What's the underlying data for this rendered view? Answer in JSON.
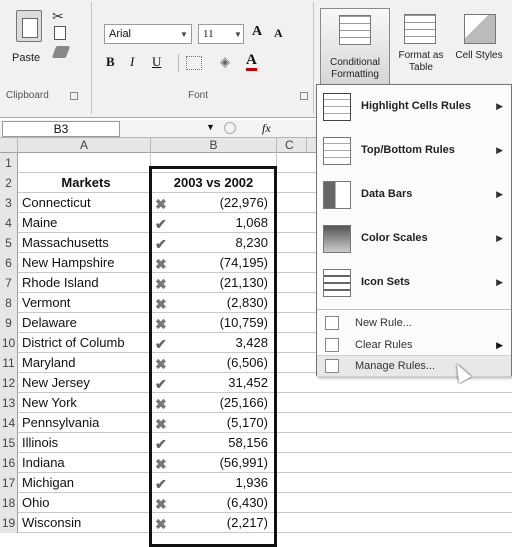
{
  "ribbon": {
    "clipboard": {
      "paste_label": "Paste",
      "group_label": "Clipboard"
    },
    "font": {
      "font_name": "Arial",
      "font_size": "11",
      "grow_label": "A",
      "shrink_label": "A",
      "bold_label": "B",
      "italic_label": "I",
      "underline_label": "U",
      "font_color_label": "A",
      "group_label": "Font"
    },
    "styles": {
      "conditional_formatting_label": "Conditional Formatting",
      "format_as_table_label": "Format as Table",
      "cell_styles_label": "Cell Styles"
    }
  },
  "formula_bar": {
    "name_box": "B3",
    "fx": "fx"
  },
  "grid": {
    "columns": [
      "A",
      "B",
      "C"
    ],
    "header_row": {
      "row_number": "2",
      "col_a": "Markets",
      "col_b": "2003 vs 2002"
    },
    "rows": [
      {
        "row_number": "3",
        "market": "Connecticut",
        "icon": "cross",
        "value": "(22,976)"
      },
      {
        "row_number": "4",
        "market": "Maine",
        "icon": "check",
        "value": "1,068"
      },
      {
        "row_number": "5",
        "market": "Massachusetts",
        "icon": "check",
        "value": "8,230"
      },
      {
        "row_number": "6",
        "market": "New Hampshire",
        "icon": "cross",
        "value": "(74,195)"
      },
      {
        "row_number": "7",
        "market": "Rhode Island",
        "icon": "cross",
        "value": "(21,130)"
      },
      {
        "row_number": "8",
        "market": "Vermont",
        "icon": "cross",
        "value": "(2,830)"
      },
      {
        "row_number": "9",
        "market": "Delaware",
        "icon": "cross",
        "value": "(10,759)"
      },
      {
        "row_number": "10",
        "market": "District of Columb",
        "icon": "check",
        "value": "3,428"
      },
      {
        "row_number": "11",
        "market": "Maryland",
        "icon": "cross",
        "value": "(6,506)"
      },
      {
        "row_number": "12",
        "market": "New Jersey",
        "icon": "check",
        "value": "31,452"
      },
      {
        "row_number": "13",
        "market": "New York",
        "icon": "cross",
        "value": "(25,166)"
      },
      {
        "row_number": "14",
        "market": "Pennsylvania",
        "icon": "cross",
        "value": "(5,170)"
      },
      {
        "row_number": "15",
        "market": "Illinois",
        "icon": "check",
        "value": "58,156"
      },
      {
        "row_number": "16",
        "market": "Indiana",
        "icon": "cross",
        "value": "(56,991)"
      },
      {
        "row_number": "17",
        "market": "Michigan",
        "icon": "check",
        "value": "1,936"
      },
      {
        "row_number": "18",
        "market": "Ohio",
        "icon": "cross",
        "value": "(6,430)"
      },
      {
        "row_number": "19",
        "market": "Wisconsin",
        "icon": "cross",
        "value": "(2,217)"
      }
    ],
    "empty_row_number": "1"
  },
  "menu": {
    "items": [
      {
        "label": "Highlight Cells Rules",
        "icon": "highlight-cells-icon",
        "has_submenu": true
      },
      {
        "label": "Top/Bottom Rules",
        "icon": "top-bottom-icon",
        "has_submenu": true
      },
      {
        "label": "Data Bars",
        "icon": "data-bars-icon",
        "has_submenu": true
      },
      {
        "label": "Color Scales",
        "icon": "color-scales-icon",
        "has_submenu": true
      },
      {
        "label": "Icon Sets",
        "icon": "icon-sets-icon",
        "has_submenu": true
      }
    ],
    "small_items": [
      {
        "label": "New Rule...",
        "icon": "new-rule-icon"
      },
      {
        "label": "Clear Rules",
        "icon": "clear-rules-icon",
        "has_submenu": true
      },
      {
        "label": "Manage Rules...",
        "icon": "manage-rules-icon"
      }
    ]
  }
}
